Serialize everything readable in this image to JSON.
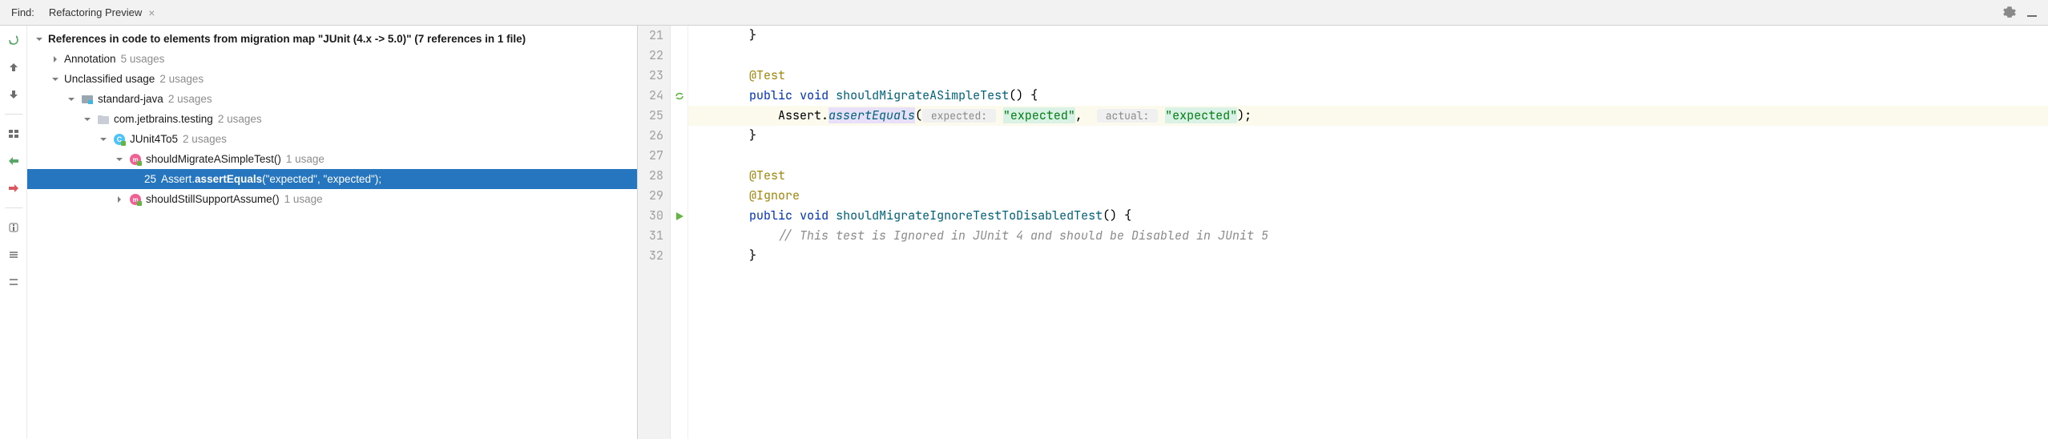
{
  "header": {
    "find_label": "Find:",
    "tab_title": "Refactoring Preview"
  },
  "tree": {
    "root": {
      "label": "References in code to elements from migration map \"JUnit (4.x -> 5.0)\"  (7 references in 1 file)"
    },
    "annotation": {
      "label": "Annotation",
      "usages": "5 usages"
    },
    "unclassified": {
      "label": "Unclassified usage",
      "usages": "2 usages"
    },
    "module": {
      "label": "standard-java",
      "usages": "2 usages"
    },
    "package": {
      "label": "com.jetbrains.testing",
      "usages": "2 usages"
    },
    "class": {
      "label": "JUnit4To5",
      "usages": "2 usages"
    },
    "method1": {
      "label": "shouldMigrateASimpleTest()",
      "usages": "1 usage"
    },
    "usageline": {
      "num": "25",
      "pre": "Assert.",
      "bold": "assertEquals",
      "post": "(\"expected\", \"expected\");"
    },
    "method2": {
      "label": "shouldStillSupportAssume()",
      "usages": "1 usage"
    }
  },
  "editor": {
    "lines": [
      {
        "n": "21",
        "indent": "        ",
        "tokens": [
          {
            "t": "}",
            "c": "punc"
          }
        ]
      },
      {
        "n": "22",
        "indent": "",
        "tokens": []
      },
      {
        "n": "23",
        "indent": "        ",
        "tokens": [
          {
            "t": "@Test",
            "c": "ann"
          }
        ]
      },
      {
        "n": "24",
        "indent": "        ",
        "gut": "chg",
        "tokens": [
          {
            "t": "public",
            "c": "kw"
          },
          {
            "t": " "
          },
          {
            "t": "void",
            "c": "kw"
          },
          {
            "t": " "
          },
          {
            "t": "shouldMigrateASimpleTest",
            "c": "method"
          },
          {
            "t": "() {",
            "c": "punc"
          }
        ]
      },
      {
        "n": "25",
        "indent": "            ",
        "current": true,
        "tokens": [
          {
            "t": "Assert."
          },
          {
            "t": "assertEquals",
            "c": "methodhi"
          },
          {
            "t": "("
          },
          {
            "t": " expected: ",
            "c": "hint"
          },
          {
            "t": " "
          },
          {
            "t": "\"expected\"",
            "c": "strhi"
          },
          {
            "t": ",  "
          },
          {
            "t": " actual: ",
            "c": "hint"
          },
          {
            "t": " "
          },
          {
            "t": "\"expected\"",
            "c": "strhi"
          },
          {
            "t": ");",
            "c": "punc"
          }
        ]
      },
      {
        "n": "26",
        "indent": "        ",
        "tokens": [
          {
            "t": "}",
            "c": "punc"
          }
        ]
      },
      {
        "n": "27",
        "indent": "",
        "tokens": []
      },
      {
        "n": "28",
        "indent": "        ",
        "tokens": [
          {
            "t": "@Test",
            "c": "ann"
          }
        ]
      },
      {
        "n": "29",
        "indent": "        ",
        "tokens": [
          {
            "t": "@Ignore",
            "c": "ann"
          }
        ]
      },
      {
        "n": "30",
        "indent": "        ",
        "gut": "run",
        "tokens": [
          {
            "t": "public",
            "c": "kw"
          },
          {
            "t": " "
          },
          {
            "t": "void",
            "c": "kw"
          },
          {
            "t": " "
          },
          {
            "t": "shouldMigrateIgnoreTestToDisabledTest",
            "c": "method"
          },
          {
            "t": "() {",
            "c": "punc"
          }
        ]
      },
      {
        "n": "31",
        "indent": "            ",
        "tokens": [
          {
            "t": "// This test is Ignored in JUnit 4 and should be Disabled in JUnit 5",
            "c": "comment"
          }
        ]
      },
      {
        "n": "32",
        "indent": "        ",
        "tokens": [
          {
            "t": "}",
            "c": "punc"
          }
        ]
      }
    ]
  }
}
